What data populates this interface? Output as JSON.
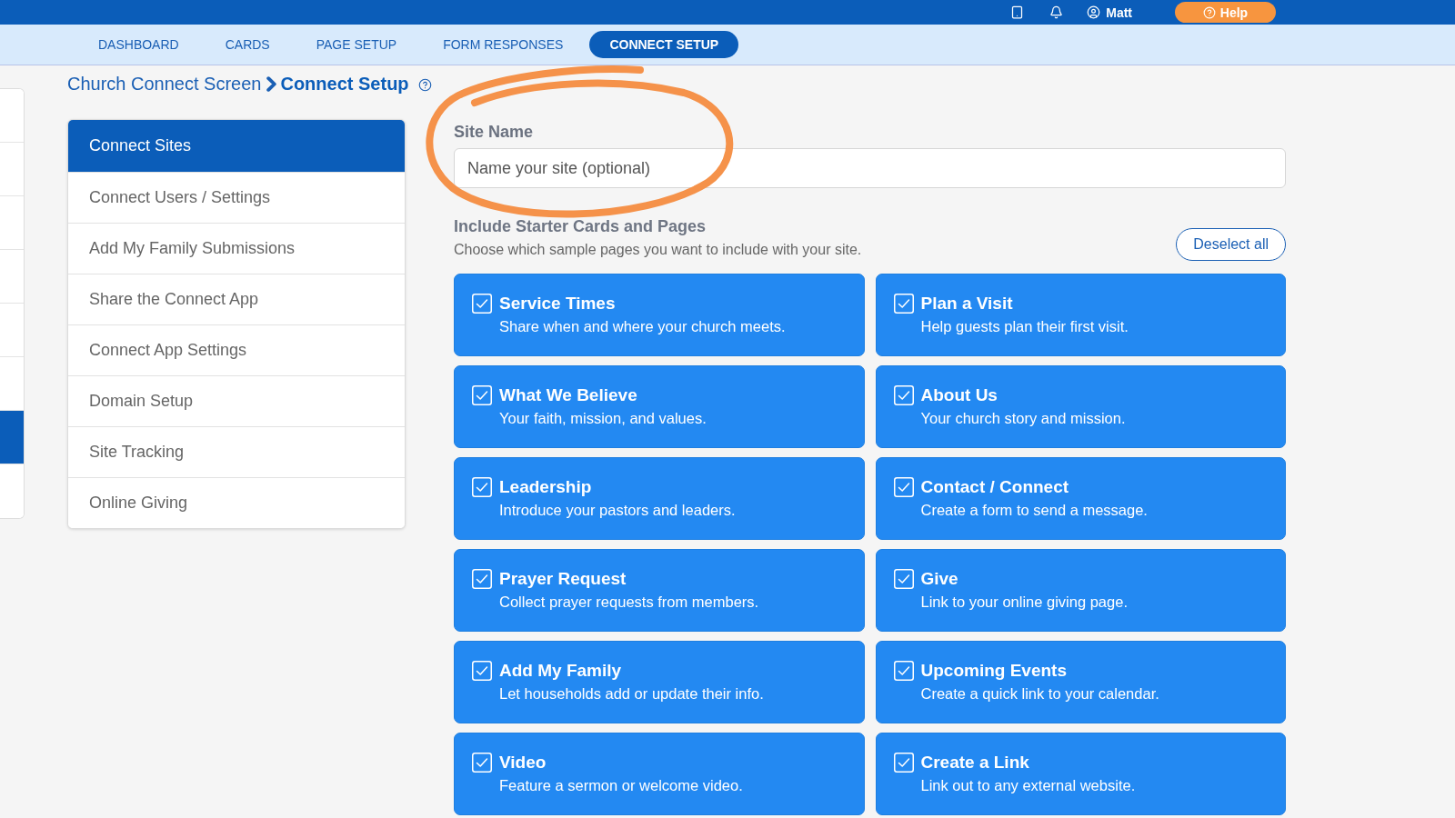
{
  "top_bar": {
    "user": "Matt",
    "help_button": "Help"
  },
  "nav_tabs": [
    {
      "label": "DASHBOARD",
      "selected": false
    },
    {
      "label": "CARDS",
      "selected": false
    },
    {
      "label": "PAGE SETUP",
      "selected": false
    },
    {
      "label": "FORM RESPONSES",
      "selected": false
    },
    {
      "label": "CONNECT SETUP",
      "selected": true
    }
  ],
  "breadcrumb": {
    "parent": "Church Connect Screen",
    "current": "Connect Setup"
  },
  "left_panel": {
    "rows": [
      {
        "selected": false
      },
      {
        "selected": false
      },
      {
        "selected": false
      },
      {
        "selected": false
      },
      {
        "selected": false
      },
      {
        "selected": false
      },
      {
        "selected": true
      },
      {
        "selected": false
      }
    ]
  },
  "sidebar": {
    "items": [
      {
        "label": "Connect Sites",
        "selected": true
      },
      {
        "label": "Connect Users / Settings",
        "selected": false
      },
      {
        "label": "Add My Family Submissions",
        "selected": false
      },
      {
        "label": "Share the Connect App",
        "selected": false
      },
      {
        "label": "Connect App Settings",
        "selected": false
      },
      {
        "label": "Domain Setup",
        "selected": false
      },
      {
        "label": "Site Tracking",
        "selected": false
      },
      {
        "label": "Online Giving",
        "selected": false
      }
    ]
  },
  "site_name": {
    "label": "Site Name",
    "placeholder": "Name your site (optional)"
  },
  "starter_section": {
    "title": "Include Starter Cards and Pages",
    "description": "Choose which sample pages you want to include with your site.",
    "deselect_button": "Deselect all"
  },
  "cards": [
    {
      "title": "Service Times",
      "description": "Share when and where your church meets.",
      "checked": true
    },
    {
      "title": "Plan a Visit",
      "description": "Help guests plan their first visit.",
      "checked": true
    },
    {
      "title": "What We Believe",
      "description": "Your faith, mission, and values.",
      "checked": true
    },
    {
      "title": "About Us",
      "description": "Your church story and mission.",
      "checked": true
    },
    {
      "title": "Leadership",
      "description": "Introduce your pastors and leaders.",
      "checked": true
    },
    {
      "title": "Contact / Connect",
      "description": "Create a form to send a message.",
      "checked": true
    },
    {
      "title": "Prayer Request",
      "description": "Collect prayer requests from members.",
      "checked": true
    },
    {
      "title": "Give",
      "description": "Link to your online giving page.",
      "checked": true
    },
    {
      "title": "Add My Family",
      "description": "Let households add or update their info.",
      "checked": true
    },
    {
      "title": "Upcoming Events",
      "description": "Create a quick link to your calendar.",
      "checked": true
    },
    {
      "title": "Video",
      "description": "Feature a sermon or welcome video.",
      "checked": true
    },
    {
      "title": "Create a Link",
      "description": "Link out to any external website.",
      "checked": true
    }
  ]
}
